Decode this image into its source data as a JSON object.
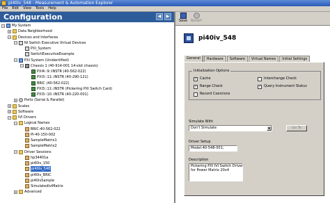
{
  "window": {
    "title": "pi40iv_548 - Measurement & Automation Explorer"
  },
  "menu": [
    "File",
    "Edit",
    "View",
    "Tools",
    "Help"
  ],
  "config_header": {
    "title": "Configuration"
  },
  "tree": [
    {
      "label": "My System",
      "depth": 0,
      "expander": "−",
      "icon": "pc"
    },
    {
      "label": "Data Neighborhood",
      "depth": 1,
      "expander": "+",
      "icon": "folder"
    },
    {
      "label": "Devices and Interfaces",
      "depth": 1,
      "expander": "−",
      "icon": "folder"
    },
    {
      "label": "NI Switch Executive Virtual Devices",
      "depth": 2,
      "expander": "−",
      "icon": "switch"
    },
    {
      "label": "PXI_System",
      "depth": 3,
      "expander": "",
      "icon": "switch"
    },
    {
      "label": "SwitchExecutiveExample",
      "depth": 3,
      "expander": "",
      "icon": "switch"
    },
    {
      "label": "PXI System (Unidentified)",
      "depth": 2,
      "expander": "−",
      "icon": "pc"
    },
    {
      "label": "Chassis 1 (40-914-001 14-slot chassis)",
      "depth": 3,
      "expander": "−",
      "icon": "chassis"
    },
    {
      "label": "PXI4::9::INSTR (40-562-022)",
      "depth": 4,
      "expander": "",
      "icon": "chip"
    },
    {
      "label": "PXI3::11::INSTR (40-290-121)",
      "depth": 4,
      "expander": "",
      "icon": "chip"
    },
    {
      "label": "BRIC (40-562-022)",
      "depth": 4,
      "expander": "",
      "icon": "chip"
    },
    {
      "label": "PXI3::11::INSTR (Pickering PXI Switch Card)",
      "depth": 4,
      "expander": "",
      "icon": "chip"
    },
    {
      "label": "PXI3::10::INSTR (40-220-001)",
      "depth": 4,
      "expander": "",
      "icon": "chip"
    },
    {
      "label": "Ports (Serial & Parallel)",
      "depth": 2,
      "expander": "+",
      "icon": "gear"
    },
    {
      "label": "Scales",
      "depth": 1,
      "expander": "+",
      "icon": "folder"
    },
    {
      "label": "Software",
      "depth": 1,
      "expander": "+",
      "icon": "folder"
    },
    {
      "label": "IVI Drivers",
      "depth": 1,
      "expander": "−",
      "icon": "folder"
    },
    {
      "label": "Logical Names",
      "depth": 2,
      "expander": "−",
      "icon": "folder"
    },
    {
      "label": "BRIC-40-562-022",
      "depth": 3,
      "expander": "",
      "icon": "driver"
    },
    {
      "label": "PI-40-150-002",
      "depth": 3,
      "expander": "",
      "icon": "driver"
    },
    {
      "label": "SampleMatrix1",
      "depth": 3,
      "expander": "",
      "icon": "driver"
    },
    {
      "label": "SampleMatrix2",
      "depth": 3,
      "expander": "",
      "icon": "driver"
    },
    {
      "label": "Driver Sessions",
      "depth": 2,
      "expander": "−",
      "icon": "folder"
    },
    {
      "label": "hp34401a",
      "depth": 3,
      "expander": "",
      "icon": "driver"
    },
    {
      "label": "pi40iv_150",
      "depth": 3,
      "expander": "",
      "icon": "driver"
    },
    {
      "label": "pi40iv_548",
      "depth": 3,
      "expander": "",
      "icon": "driver",
      "selected": true
    },
    {
      "label": "pi40iv_BRIC",
      "depth": 3,
      "expander": "",
      "icon": "driver"
    },
    {
      "label": "pi40ivSample",
      "depth": 3,
      "expander": "",
      "icon": "driver"
    },
    {
      "label": "SimulatedIviMatrix",
      "depth": 3,
      "expander": "",
      "icon": "driver"
    },
    {
      "label": "Advanced",
      "depth": 2,
      "expander": "+",
      "icon": "folder"
    }
  ],
  "toolbar": {
    "save_label": "Save",
    "revert_label": "Revert"
  },
  "session": {
    "title": "pi40iv_548"
  },
  "tabs": [
    "General",
    "Hardware",
    "Software",
    "Virtual Names",
    "Initial Settings"
  ],
  "init_options": {
    "title": "Initialization Options",
    "items": [
      {
        "label": "Cache",
        "checked": true
      },
      {
        "label": "Range Check",
        "checked": true
      },
      {
        "label": "Record Coercions",
        "checked": false
      },
      {
        "label": "Interchange Check",
        "checked": false
      },
      {
        "label": "Query Instrument Status",
        "checked": true
      }
    ]
  },
  "simulate": {
    "label": "Simulate With",
    "value": "Don't Simulate",
    "goto_label": "Go To"
  },
  "driver_setup": {
    "label": "Driver Setup",
    "value": "Model:40-548-001;"
  },
  "description": {
    "label": "Description",
    "lines": [
      "Pickering PXI IVI Switch Driver",
      "for Power Matrix 20x4"
    ]
  }
}
